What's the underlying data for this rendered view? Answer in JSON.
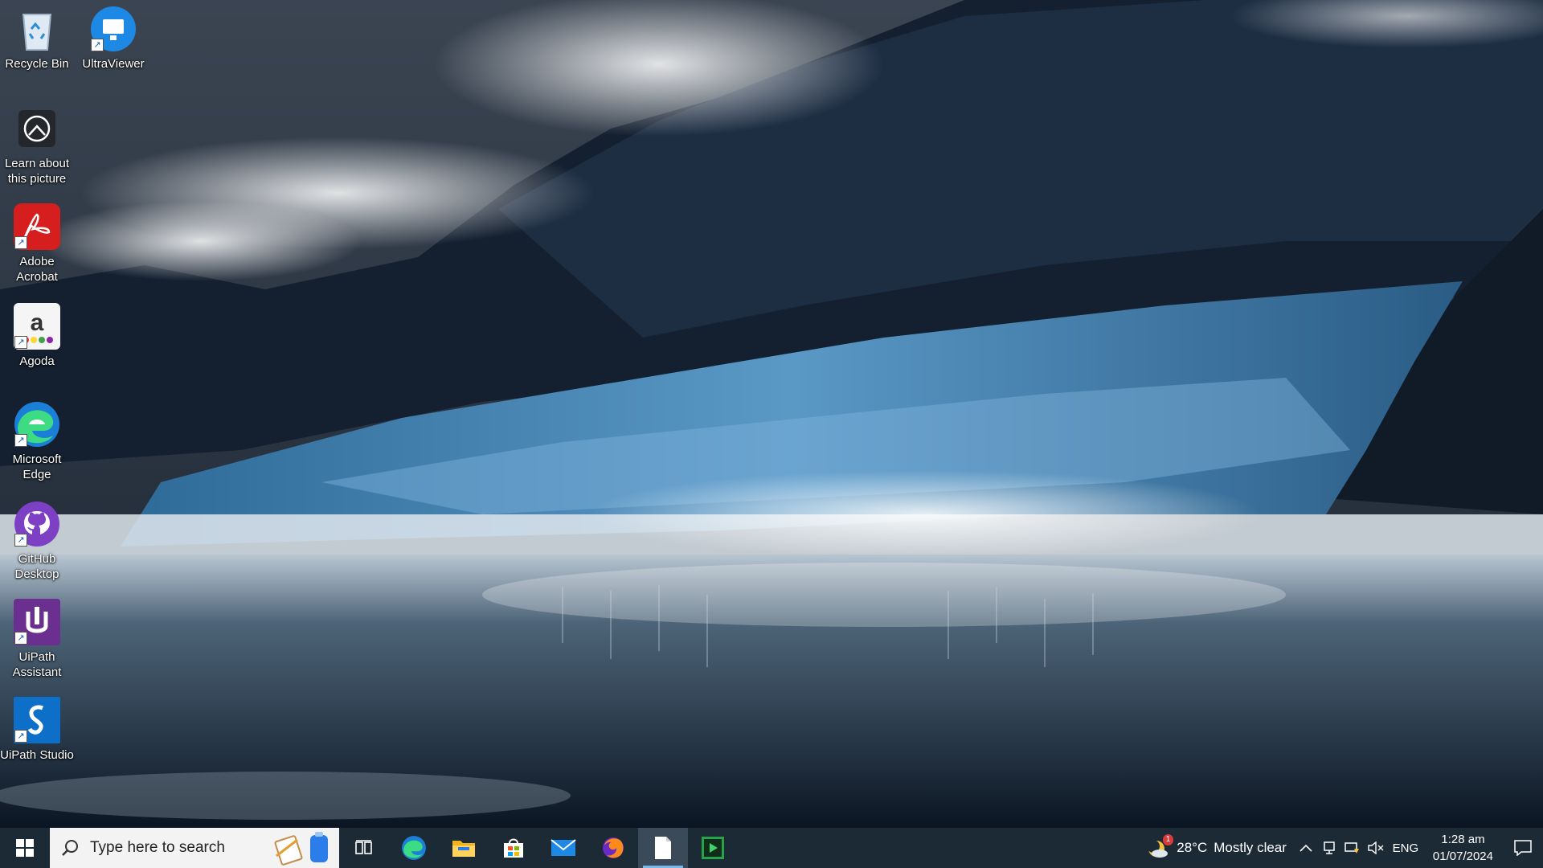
{
  "desktop": {
    "icons": [
      {
        "label": "Recycle Bin",
        "icon": "recycle-bin-icon"
      },
      {
        "label": "UltraViewer",
        "icon": "ultraviewer-icon"
      },
      {
        "label": "Learn about this picture",
        "icon": "learn-picture-icon"
      },
      {
        "label": "Adobe Acrobat",
        "icon": "adobe-acrobat-icon"
      },
      {
        "label": "Agoda",
        "icon": "agoda-icon"
      },
      {
        "label": "Microsoft Edge",
        "icon": "edge-icon"
      },
      {
        "label": "GitHub Desktop",
        "icon": "github-icon"
      },
      {
        "label": "UiPath Assistant",
        "icon": "uipath-assistant-icon"
      },
      {
        "label": "UiPath Studio",
        "icon": "uipath-studio-icon"
      }
    ]
  },
  "taskbar": {
    "search_placeholder": "Type here to search",
    "pinned": [
      "start-icon",
      "task-view-icon",
      "edge-icon",
      "file-explorer-icon",
      "microsoft-store-icon",
      "mail-icon",
      "firefox-icon",
      "notepad-icon",
      "media-player-icon"
    ],
    "weather": {
      "temperature": "28°C",
      "condition": "Mostly clear",
      "badge": "1"
    },
    "tray": {
      "language": "ENG"
    },
    "clock": {
      "time": "1:28 am",
      "date": "01/07/2024"
    }
  },
  "colors": {
    "taskbar_bg": "#1c2a36",
    "active_indicator": "#76b9ed",
    "search_bg": "#f3f3f3"
  }
}
